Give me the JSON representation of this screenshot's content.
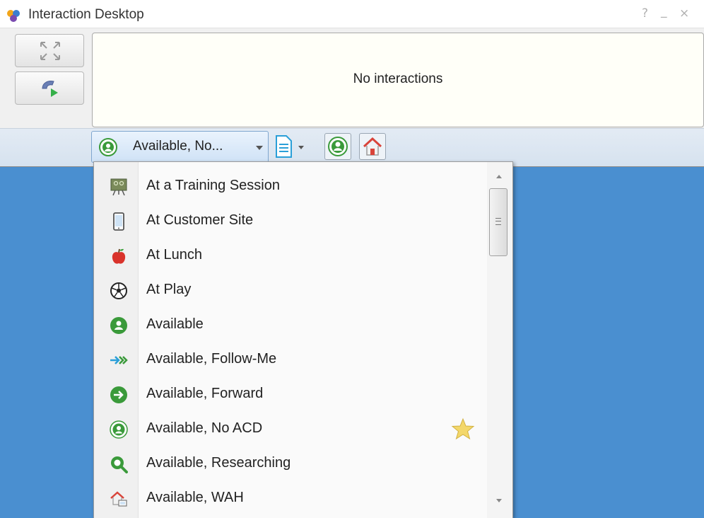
{
  "window": {
    "title": "Interaction Desktop",
    "help_glyph": "?",
    "minimize_glyph": "_",
    "close_glyph": "×"
  },
  "interactions": {
    "empty_message": "No interactions"
  },
  "toolbar": {
    "current_status": "Available, No..."
  },
  "status_menu": {
    "items": [
      {
        "label": "At a Training Session",
        "icon": "training-board-icon"
      },
      {
        "label": "At Customer Site",
        "icon": "mobile-phone-icon"
      },
      {
        "label": "At Lunch",
        "icon": "apple-icon"
      },
      {
        "label": "At Play",
        "icon": "soccer-ball-icon"
      },
      {
        "label": "Available",
        "icon": "available-person-icon"
      },
      {
        "label": "Available, Follow-Me",
        "icon": "follow-me-arrows-icon"
      },
      {
        "label": "Available, Forward",
        "icon": "forward-arrow-icon"
      },
      {
        "label": "Available, No ACD",
        "icon": "available-no-acd-icon",
        "favorite": true
      },
      {
        "label": "Available, Researching",
        "icon": "magnifier-icon"
      },
      {
        "label": "Available, WAH",
        "icon": "home-computer-icon"
      }
    ]
  },
  "colors": {
    "desktop_bg": "#4a8fd0",
    "status_green": "#3a9a3a",
    "accent_blue": "#2a9fd8",
    "home_red": "#d9443a",
    "favorite_star": "#f3d76a"
  }
}
